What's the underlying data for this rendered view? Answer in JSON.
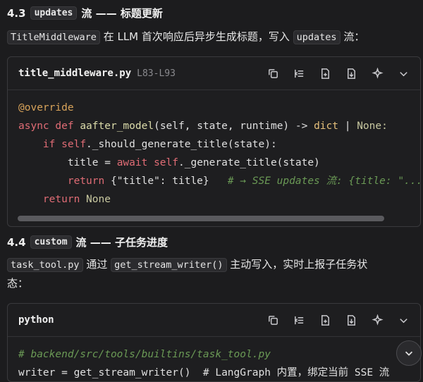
{
  "section_a": {
    "num": "4.3",
    "code": "updates",
    "title": "流 —— 标题更新",
    "desc_code": "TitleMiddleware",
    "desc_text1": " 在 LLM 首次响应后异步生成标题，写入 ",
    "desc_code2": "updates",
    "desc_text2": " 流："
  },
  "block_a": {
    "filename": "title_middleware.py",
    "lines": "L83-L93",
    "code": {
      "l1": "@override",
      "l2_kw1": "async",
      "l2_kw2": "def",
      "l2_fn": "aafter_model",
      "l2_args": "(self, state, runtime) -> ",
      "l2_ty": "dict",
      "l2_mid": " | ",
      "l2_none": "None:",
      "l3_kw": "if",
      "l3_self": "self",
      "l3_rest": "._should_generate_title(state):",
      "l4_a": "title = ",
      "l4_kw": "await",
      "l4_self": "self",
      "l4_rest": "._generate_title(state)",
      "l5_kw": "return",
      "l5_rest": " {\"title\": title}",
      "l5_cm": "# → SSE updates 流: {title: \"...\"}",
      "l6_kw": "return",
      "l6_none": "None"
    }
  },
  "section_b": {
    "num": "4.4",
    "code": "custom",
    "title": "流 —— 子任务进度",
    "desc_code": "task_tool.py",
    "desc_text1": " 通过 ",
    "desc_code2": "get_stream_writer()",
    "desc_text2": " 主动写入，实时上报子任务状",
    "desc_text3": "态："
  },
  "block_b": {
    "filename": "python",
    "code": {
      "l1": "# backend/src/tools/builtins/task_tool.py",
      "l2": "writer = get_stream_writer()  # LangGraph 内置，绑定当前 SSE 流"
    }
  },
  "icons": [
    "copy-icon",
    "insert-icon",
    "new-file-icon",
    "apply-icon",
    "sparkle-icon",
    "chevron-down-icon",
    "scroll-down-icon"
  ]
}
